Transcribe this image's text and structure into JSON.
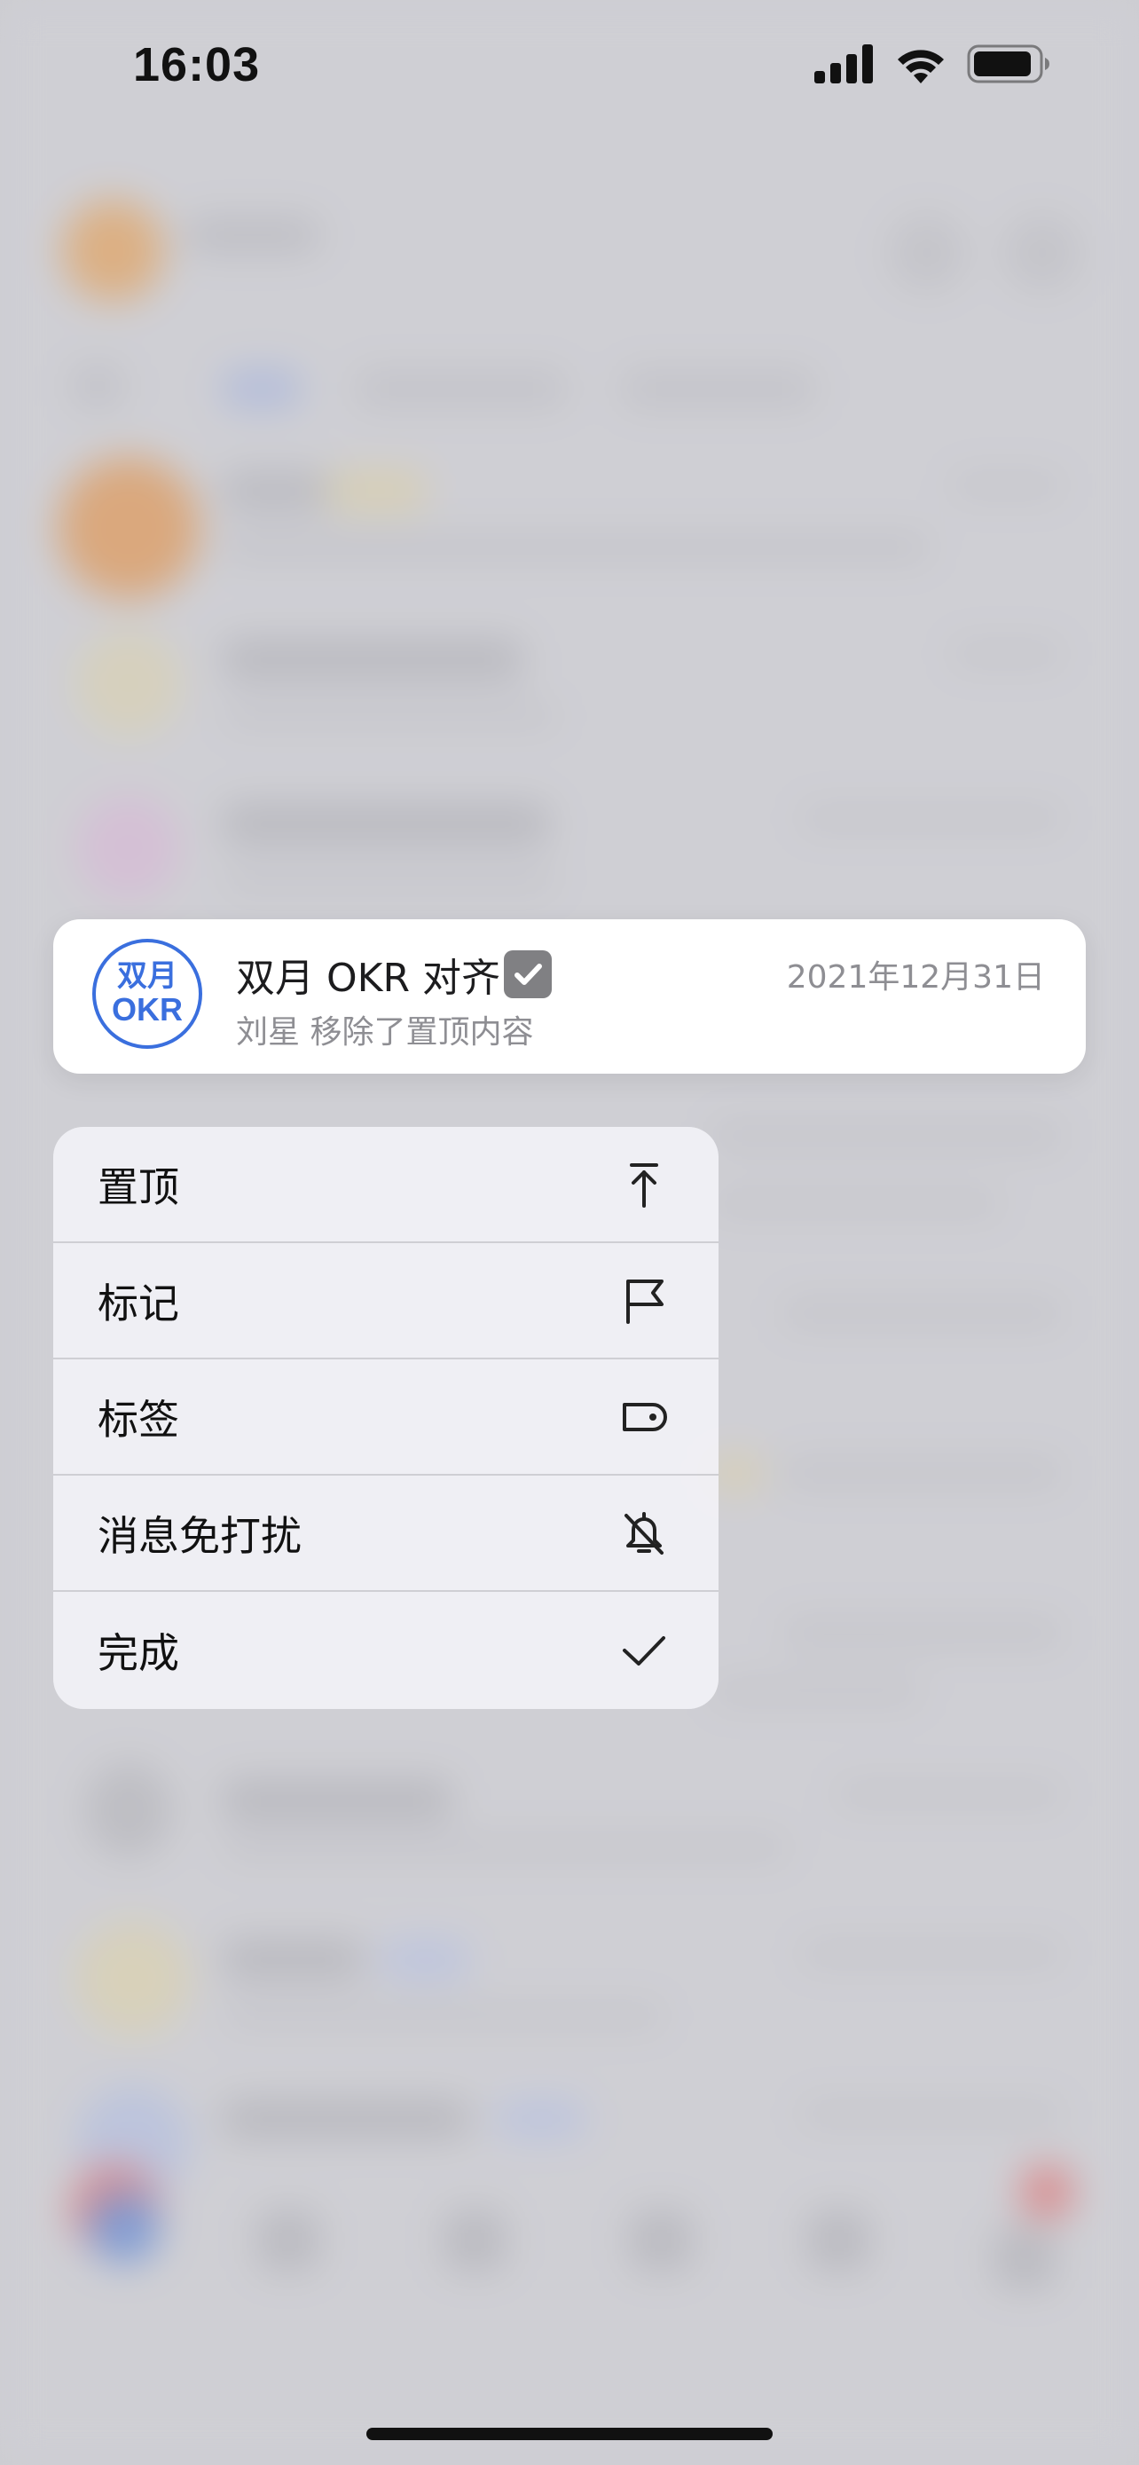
{
  "status_bar": {
    "time": "16:03"
  },
  "chat_preview": {
    "avatar_line1": "双月",
    "avatar_line2": "OKR",
    "title": "双月 OKR 对齐",
    "date": "2021年12月31日",
    "subtitle": "刘星 移除了置顶内容"
  },
  "context_menu": {
    "items": [
      {
        "label": "置顶",
        "icon": "pin-top-icon"
      },
      {
        "label": "标记",
        "icon": "flag-icon"
      },
      {
        "label": "标签",
        "icon": "tag-icon"
      },
      {
        "label": "消息免打扰",
        "icon": "bell-slash-icon"
      },
      {
        "label": "完成",
        "icon": "checkmark-icon"
      }
    ]
  },
  "colors": {
    "accent": "#3a6fde",
    "menu_bg": "#f2f2f6",
    "card_bg": "#ffffff"
  }
}
